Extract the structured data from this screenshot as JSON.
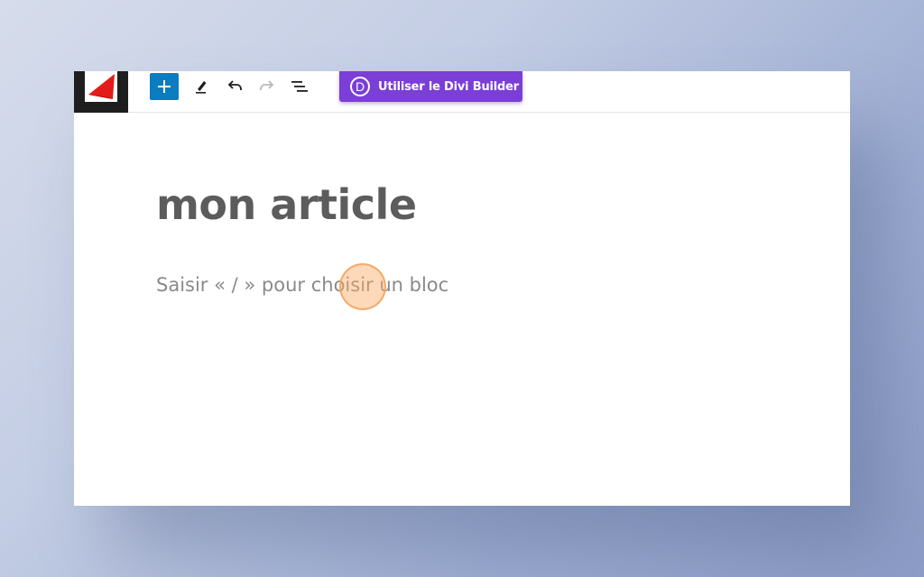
{
  "toolbar": {
    "add_block_icon": "plus-icon",
    "tools": [
      "pencil-icon",
      "undo-icon",
      "redo-icon",
      "list-view-icon"
    ],
    "divi_button": {
      "logo_letter": "D",
      "label": "Utiliser le Divi Builder"
    }
  },
  "editor": {
    "post_title": "mon article",
    "block_placeholder": "Saisir « / » pour choisir un bloc"
  },
  "colors": {
    "accent_blue": "#0a7cbf",
    "divi_purple": "#7b3ed6",
    "logo_red": "#e31b1b",
    "cursor_highlight": "#f5a05a"
  }
}
